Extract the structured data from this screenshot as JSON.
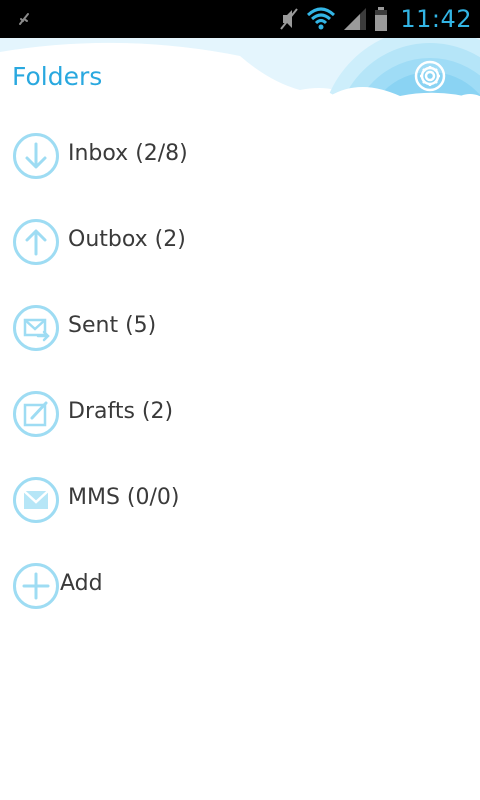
{
  "status_bar": {
    "time": "11:42",
    "icons": [
      "usb-icon",
      "mute-icon",
      "wifi-icon",
      "signal-icon",
      "battery-icon"
    ]
  },
  "header": {
    "title": "Folders",
    "settings_icon": "gear-icon"
  },
  "folders": [
    {
      "label": "Inbox (2/8)",
      "icon": "inbox-download-icon"
    },
    {
      "label": "Outbox (2)",
      "icon": "outbox-upload-icon"
    },
    {
      "label": "Sent (5)",
      "icon": "sent-envelope-icon"
    },
    {
      "label": "Drafts (2)",
      "icon": "drafts-edit-icon"
    },
    {
      "label": "MMS (0/0)",
      "icon": "mms-envelope-icon"
    }
  ],
  "add": {
    "label": "Add",
    "icon": "plus-icon"
  },
  "colors": {
    "accent": "#33b5e5",
    "title": "#29a8df",
    "icon_stroke": "#9edcf3",
    "text": "#3a3a3a"
  }
}
